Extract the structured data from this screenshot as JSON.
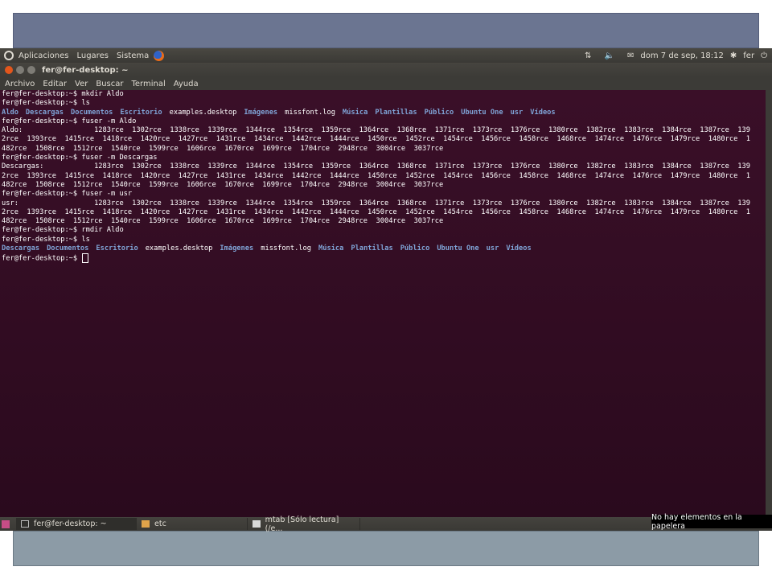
{
  "top_panel": {
    "menus": [
      "Aplicaciones",
      "Lugares",
      "Sistema"
    ],
    "clock": "dom 7 de sep, 18:12",
    "user": "fer"
  },
  "window": {
    "title": "fer@fer-desktop: ~"
  },
  "menubar": {
    "items": [
      "Archivo",
      "Editar",
      "Ver",
      "Buscar",
      "Terminal",
      "Ayuda"
    ]
  },
  "terminal": {
    "lines": [
      [
        {
          "t": "fer@fer-desktop:~$ mkdir Aldo",
          "c": "p"
        }
      ],
      [
        {
          "t": "fer@fer-desktop:~$ ls",
          "c": "p"
        }
      ],
      [
        {
          "t": "Aldo",
          "c": "d"
        },
        {
          "t": "Descargas",
          "c": "d"
        },
        {
          "t": "Documentos",
          "c": "d"
        },
        {
          "t": "Escritorio",
          "c": "d"
        },
        {
          "t": "examples.desktop",
          "c": "f"
        },
        {
          "t": "Imágenes",
          "c": "d"
        },
        {
          "t": "missfont.log",
          "c": "f"
        },
        {
          "t": "Música",
          "c": "d"
        },
        {
          "t": "Plantillas",
          "c": "d"
        },
        {
          "t": "Público",
          "c": "d"
        },
        {
          "t": "Ubuntu One",
          "c": "d"
        },
        {
          "t": "usr",
          "c": "d"
        },
        {
          "t": "Vídeos",
          "c": "d"
        }
      ],
      [
        {
          "t": "fer@fer-desktop:~$ fuser -m Aldo",
          "c": "p"
        }
      ],
      [
        {
          "t": "Aldo:                 1283rce  1302rce  1338rce  1339rce  1344rce  1354rce  1359rce  1364rce  1368rce  1371rce  1373rce  1376rce  1380rce  1382rce  1383rce  1384rce  1387rce  139",
          "c": "p"
        }
      ],
      [
        {
          "t": "2rce  1393rce  1415rce  1418rce  1420rce  1427rce  1431rce  1434rce  1442rce  1444rce  1450rce  1452rce  1454rce  1456rce  1458rce  1468rce  1474rce  1476rce  1479rce  1480rce  1",
          "c": "p"
        }
      ],
      [
        {
          "t": "482rce  1508rce  1512rce  1540rce  1599rce  1606rce  1670rce  1699rce  1704rce  2948rce  3004rce  3037rce",
          "c": "p"
        }
      ],
      [
        {
          "t": "fer@fer-desktop:~$ fuser -m Descargas",
          "c": "p"
        }
      ],
      [
        {
          "t": "Descargas:            1283rce  1302rce  1338rce  1339rce  1344rce  1354rce  1359rce  1364rce  1368rce  1371rce  1373rce  1376rce  1380rce  1382rce  1383rce  1384rce  1387rce  139",
          "c": "p"
        }
      ],
      [
        {
          "t": "2rce  1393rce  1415rce  1418rce  1420rce  1427rce  1431rce  1434rce  1442rce  1444rce  1450rce  1452rce  1454rce  1456rce  1458rce  1468rce  1474rce  1476rce  1479rce  1480rce  1",
          "c": "p"
        }
      ],
      [
        {
          "t": "482rce  1508rce  1512rce  1540rce  1599rce  1606rce  1670rce  1699rce  1704rce  2948rce  3004rce  3037rce",
          "c": "p"
        }
      ],
      [
        {
          "t": "fer@fer-desktop:~$ fuser -m usr",
          "c": "p"
        }
      ],
      [
        {
          "t": "usr:                  1283rce  1302rce  1338rce  1339rce  1344rce  1354rce  1359rce  1364rce  1368rce  1371rce  1373rce  1376rce  1380rce  1382rce  1383rce  1384rce  1387rce  139",
          "c": "p"
        }
      ],
      [
        {
          "t": "2rce  1393rce  1415rce  1418rce  1420rce  1427rce  1431rce  1434rce  1442rce  1444rce  1450rce  1452rce  1454rce  1456rce  1458rce  1468rce  1474rce  1476rce  1479rce  1480rce  1",
          "c": "p"
        }
      ],
      [
        {
          "t": "482rce  1508rce  1512rce  1540rce  1599rce  1606rce  1670rce  1699rce  1704rce  2948rce  3004rce  3037rce",
          "c": "p"
        }
      ],
      [
        {
          "t": "fer@fer-desktop:~$ rmdir Aldo",
          "c": "p"
        }
      ],
      [
        {
          "t": "fer@fer-desktop:~$ ls",
          "c": "p"
        }
      ],
      [
        {
          "t": "Descargas",
          "c": "d"
        },
        {
          "t": "Documentos",
          "c": "d"
        },
        {
          "t": "Escritorio",
          "c": "d"
        },
        {
          "t": "examples.desktop",
          "c": "f"
        },
        {
          "t": "Imágenes",
          "c": "d"
        },
        {
          "t": "missfont.log",
          "c": "f"
        },
        {
          "t": "Música",
          "c": "d"
        },
        {
          "t": "Plantillas",
          "c": "d"
        },
        {
          "t": "Público",
          "c": "d"
        },
        {
          "t": "Ubuntu One",
          "c": "d"
        },
        {
          "t": "usr",
          "c": "d"
        },
        {
          "t": "Vídeos",
          "c": "d"
        }
      ],
      [
        {
          "t": "fer@fer-desktop:~$ ",
          "c": "p"
        }
      ]
    ]
  },
  "taskbar": {
    "items": [
      {
        "label": "fer@fer-desktop: ~",
        "icon": "terminal-icon"
      },
      {
        "label": "etc",
        "icon": "folder-icon"
      },
      {
        "label": "mtab [Sólo lectura] (/e...",
        "icon": "text-editor-icon"
      }
    ],
    "trash_tooltip": "No hay elementos en la papelera"
  },
  "colors": {
    "terminal_bg": "#2c0d1e",
    "dir": "#7fa3d6",
    "close_button": "#e3561c"
  }
}
